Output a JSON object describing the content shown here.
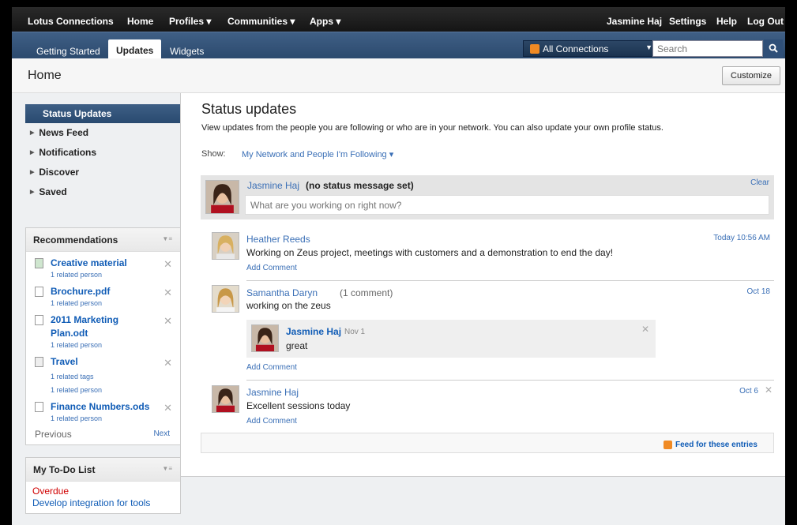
{
  "topnav": {
    "brand": "Lotus Connections",
    "home": "Home",
    "profiles": "Profiles ▾",
    "communities": "Communities ▾",
    "apps": "Apps ▾",
    "user": "Jasmine Haj",
    "settings": "Settings",
    "help": "Help",
    "logout": "Log Out"
  },
  "tabs": {
    "getting_started": "Getting Started",
    "updates": "Updates",
    "widgets": "Widgets",
    "connections": "All Connections",
    "search_placeholder": "Search"
  },
  "header": {
    "title": "Home",
    "customize": "Customize"
  },
  "sidebar": {
    "current": "Status Updates",
    "items": [
      "News Feed",
      "Notifications",
      "Discover",
      "Saved"
    ]
  },
  "recommendations": {
    "title": "Recommendations",
    "items": [
      {
        "title": "Creative material",
        "sub": [
          "1 related person"
        ]
      },
      {
        "title": "Brochure.pdf",
        "sub": [
          "1 related person"
        ]
      },
      {
        "title": "2011 Marketing Plan.odt",
        "sub": [
          "1 related person"
        ]
      },
      {
        "title": "Travel",
        "sub": [
          "1 related tags",
          "1 related person"
        ]
      },
      {
        "title": "Finance Numbers.ods",
        "sub": [
          "1 related person"
        ]
      }
    ],
    "previous": "Previous",
    "next": "Next"
  },
  "todo": {
    "title": "My To-Do List",
    "overdue": "Overdue",
    "task": "Develop integration for tools"
  },
  "main": {
    "title": "Status updates",
    "description": "View updates from the people you are following or who are in your network. You can also update your own profile status.",
    "show_label": "Show:",
    "filter": "My Network and People I'm Following ▾",
    "status": {
      "name": "Jasmine Haj",
      "message": "(no status message set)",
      "clear": "Clear",
      "placeholder": "What are you working on right now?"
    },
    "entries": [
      {
        "name": "Heather Reeds",
        "text": "Working on Zeus project, meetings with customers and a demonstration to end the day!",
        "add": "Add Comment",
        "time": "Today 10:56 AM"
      },
      {
        "name": "Samantha Daryn",
        "comments": "(1 comment)",
        "text": "working on the zeus",
        "add": "Add Comment",
        "time": "Oct 18"
      },
      {
        "name": "Jasmine Haj",
        "text": "Excellent sessions today",
        "add": "Add Comment",
        "time": "Oct 6"
      }
    ],
    "comment": {
      "name": "Jasmine Haj",
      "date": "Nov 1",
      "text": "great"
    },
    "feed": "Feed for these entries"
  },
  "colors": {
    "accent": "#2c4a6e",
    "link": "#105cb6",
    "overdue": "#d00000"
  }
}
